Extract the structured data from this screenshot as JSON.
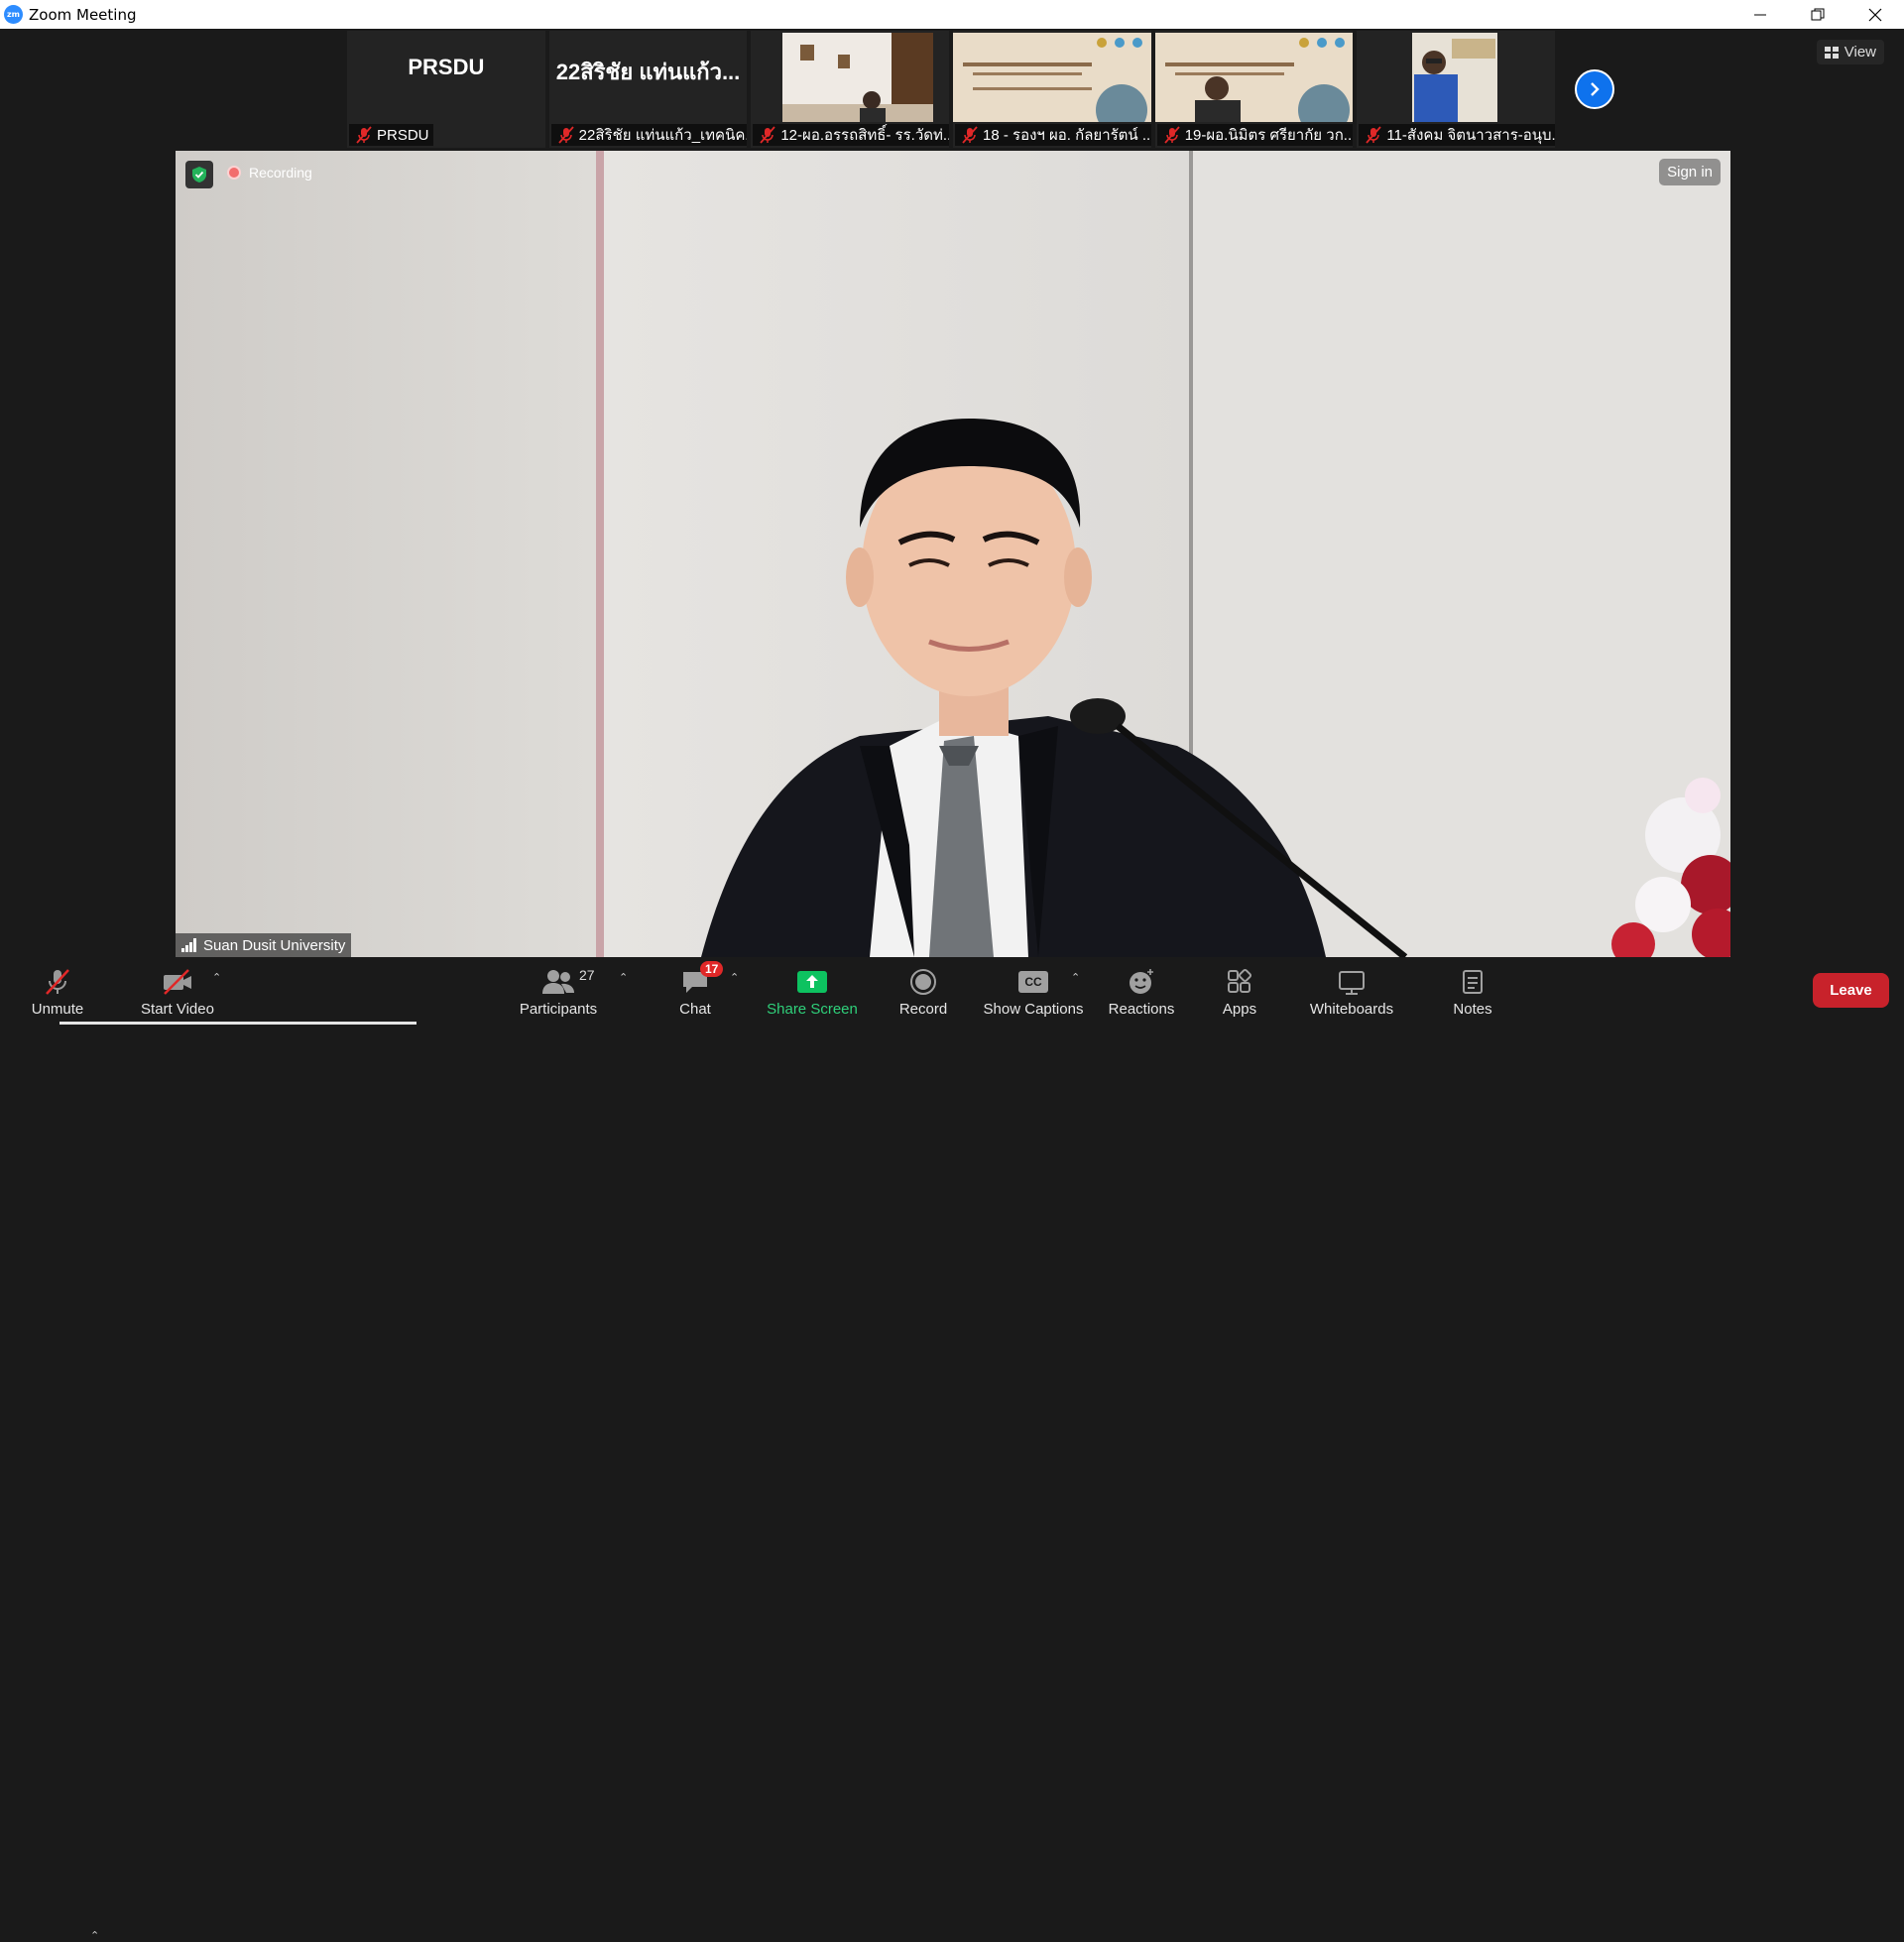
{
  "window": {
    "title": "Zoom Meeting",
    "app_logo": "zm"
  },
  "thumbnails": [
    {
      "type": "name",
      "display": "PRSDU",
      "name": "PRSDU"
    },
    {
      "type": "name",
      "display": "22สิริชัย แท่นแก้ว...",
      "name": "22สิริชัย แท่นแก้ว_เทคนิค..."
    },
    {
      "type": "video",
      "name": "12-ผอ.อรรถสิทธิ์- รร.วัดท่..."
    },
    {
      "type": "video",
      "name": "18 - รองฯ ผอ. กัลยารัตน์ ..."
    },
    {
      "type": "video",
      "name": "19-ผอ.นิมิตร ศรียากัย วก..."
    },
    {
      "type": "video",
      "name": "11-สังคม จิตนาวสาร-อนุบ..."
    }
  ],
  "view_button": {
    "label": "View",
    "icon": "grid-icon"
  },
  "main_video": {
    "recording_label": "Recording",
    "sign_in_label": "Sign in",
    "speaker_name": "Suan Dusit University"
  },
  "toolbar": {
    "unmute": "Unmute",
    "start_video": "Start Video",
    "participants": "Participants",
    "participants_count": "27",
    "chat": "Chat",
    "chat_badge": "17",
    "share_screen": "Share Screen",
    "record": "Record",
    "show_captions": "Show Captions",
    "captions_icon_text": "CC",
    "reactions": "Reactions",
    "apps": "Apps",
    "whiteboards": "Whiteboards",
    "notes": "Notes",
    "leave": "Leave"
  },
  "colors": {
    "accent_blue": "#0e72ed",
    "share_green": "#0dc260",
    "leave_red": "#c8222b",
    "mic_off_red": "#e02828"
  }
}
